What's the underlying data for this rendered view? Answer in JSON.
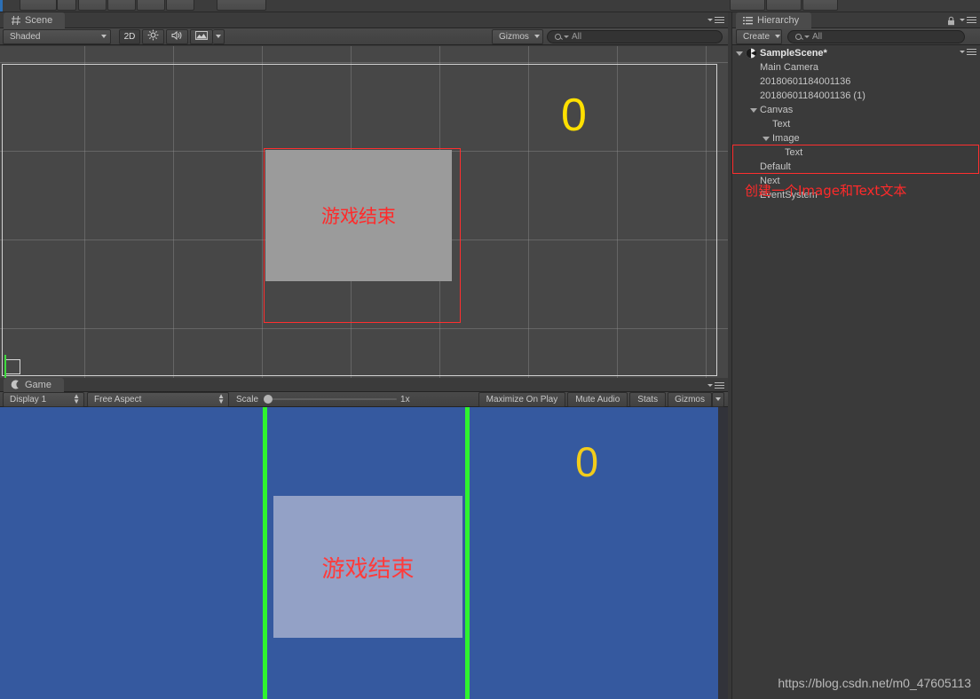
{
  "app": {
    "top_toolbar_buttons": [
      "hand-tool",
      "move-tool",
      "rotate-tool",
      "scale-tool",
      "rect-tool",
      "transform-tool"
    ],
    "play_controls": [
      "play",
      "pause",
      "step"
    ]
  },
  "scene_panel": {
    "tab_label": "Scene",
    "tab_icon": "scene-grid-icon",
    "toolbar": {
      "draw_mode": "Shaded",
      "view_2d": "2D",
      "lighting_icon": "sun-icon",
      "audio_icon": "speaker-icon",
      "effects_icon": "image-effects-icon",
      "gizmos_label": "Gizmos",
      "search_placeholder": "All"
    },
    "content": {
      "game_over_text": "游戏结束",
      "score_text": "0",
      "score_color": "#ffe000",
      "text_color": "#ff2a2a",
      "image_fill_color": "#9b9b9b",
      "selection_outline_color": "#ff2f2f",
      "grid_color": "#969696",
      "background_color": "#474747",
      "camera_rect_color": "#d2d2d2"
    }
  },
  "game_panel": {
    "tab_label": "Game",
    "tab_icon": "game-gamepad-icon",
    "toolbar": {
      "display": "Display 1",
      "aspect": "Free Aspect",
      "scale_label": "Scale",
      "scale_value": "1x",
      "maximize_on_play": "Maximize On Play",
      "mute_audio": "Mute Audio",
      "stats": "Stats",
      "gizmos_label": "Gizmos"
    },
    "content": {
      "background_color": "#35599f",
      "pipe_color": "#2ff42f",
      "panel_color": "#93a1c6",
      "game_over_text": "游戏结束",
      "score_text": "0",
      "score_color": "#f2cc1b",
      "text_color": "#ff3b3b"
    }
  },
  "hierarchy_panel": {
    "tab_label": "Hierarchy",
    "tab_icon": "hierarchy-list-icon",
    "create_label": "Create",
    "search_placeholder": "All",
    "lock_icon": "lock-icon",
    "scene_name": "SampleScene*",
    "items": [
      {
        "label": "Main Camera",
        "depth": 1,
        "expandable": false
      },
      {
        "label": "20180601184001136",
        "depth": 1,
        "expandable": false
      },
      {
        "label": "20180601184001136 (1)",
        "depth": 1,
        "expandable": false
      },
      {
        "label": "Canvas",
        "depth": 1,
        "expandable": true
      },
      {
        "label": "Text",
        "depth": 2,
        "expandable": false
      },
      {
        "label": "Image",
        "depth": 2,
        "expandable": true
      },
      {
        "label": "Text",
        "depth": 3,
        "expandable": false
      },
      {
        "label": "Default",
        "depth": 1,
        "expandable": false
      },
      {
        "label": "Next",
        "depth": 1,
        "expandable": false
      },
      {
        "label": "EventSystem",
        "depth": 1,
        "expandable": false
      }
    ],
    "selection_highlight": {
      "color": "#ff2f2f",
      "from_index": 5,
      "to_index": 6
    },
    "annotation": "创建一个Image和Text文本",
    "annotation_color": "#ff2a2a"
  },
  "watermark": "https://blog.csdn.net/m0_47605113"
}
